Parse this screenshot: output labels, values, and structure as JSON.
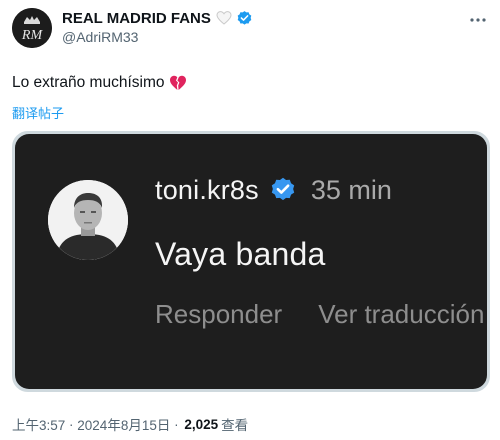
{
  "author": {
    "display_name": "REAL MADRID FANS",
    "handle": "@AdriRM33",
    "avatar_text": "RM",
    "heart_emoji": "🤍"
  },
  "tweet": {
    "text": "Lo extraño muchísimo",
    "emoji": "💔",
    "translate_label": "翻译帖子"
  },
  "embedded_card": {
    "username": "toni.kr8s",
    "time": "35 min",
    "message": "Vaya banda",
    "reply_label": "Responder",
    "translate_label": "Ver traducción"
  },
  "meta": {
    "time": "上午3:57",
    "sep1": " · ",
    "date": "2024年8月15日",
    "sep2": " · ",
    "views": "2,025",
    "views_label": "查看"
  },
  "colors": {
    "verified": "#1d9bf0",
    "link": "#1d9bf0",
    "card_bg": "#1e1e1e",
    "secondary_text": "#536471"
  }
}
